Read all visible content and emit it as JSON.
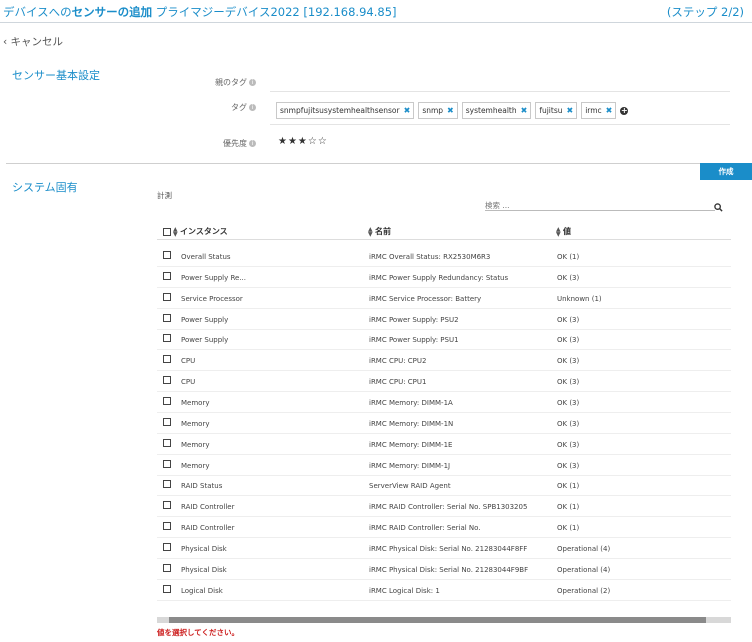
{
  "header": {
    "title_prefix": "デバイスへの",
    "title_bold": "センサーの追加",
    "title_suffix": " プライマジーデバイス2022 [192.168.94.85]",
    "step": "(ステップ 2/2)"
  },
  "cancel_label": "キャンセル",
  "basic_settings": {
    "section_title": "センサー基本設定",
    "parent_tags_label": "親のタグ",
    "tags_label": "タグ",
    "tags": [
      "snmpfujitsusystemhealthsensor",
      "snmp",
      "systemhealth",
      "fujitsu",
      "irmc"
    ],
    "priority_label": "優先度",
    "priority_stars": "★★★☆☆",
    "priority_value": 3
  },
  "system_specific": {
    "section_title": "システム固有",
    "create_button": "作成",
    "measurement_label": "計測",
    "search_placeholder": "検索 ..."
  },
  "table": {
    "columns": [
      "インスタンス",
      "名前",
      "値"
    ],
    "rows": [
      {
        "instance": "Overall Status",
        "name": "iRMC Overall Status: RX2530M6R3",
        "value": "OK (1)"
      },
      {
        "instance": "Power Supply Re...",
        "name": "iRMC Power Supply Redundancy: Status",
        "value": "OK (3)"
      },
      {
        "instance": "Service Processor",
        "name": "iRMC Service Processor: Battery",
        "value": "Unknown (1)"
      },
      {
        "instance": "Power Supply",
        "name": "iRMC Power Supply: PSU2",
        "value": "OK (3)"
      },
      {
        "instance": "Power Supply",
        "name": "iRMC Power Supply: PSU1",
        "value": "OK (3)"
      },
      {
        "instance": "CPU",
        "name": "iRMC CPU: CPU2",
        "value": "OK (3)"
      },
      {
        "instance": "CPU",
        "name": "iRMC CPU: CPU1",
        "value": "OK (3)"
      },
      {
        "instance": "Memory",
        "name": "iRMC Memory: DIMM-1A",
        "value": "OK (3)"
      },
      {
        "instance": "Memory",
        "name": "iRMC Memory: DIMM-1N",
        "value": "OK (3)"
      },
      {
        "instance": "Memory",
        "name": "iRMC Memory: DIMM-1E",
        "value": "OK (3)"
      },
      {
        "instance": "Memory",
        "name": "iRMC Memory: DIMM-1J",
        "value": "OK (3)"
      },
      {
        "instance": "RAID Status",
        "name": "ServerView RAID Agent",
        "value": "OK (1)"
      },
      {
        "instance": "RAID Controller",
        "name": "iRMC RAID Controller: Serial No. SPB1303205",
        "value": "OK (1)"
      },
      {
        "instance": "RAID Controller",
        "name": "iRMC RAID Controller: Serial No.",
        "value": "OK (1)"
      },
      {
        "instance": "Physical Disk",
        "name": "iRMC Physical Disk: Serial No. 21283044F8FF",
        "value": "Operational (4)"
      },
      {
        "instance": "Physical Disk",
        "name": "iRMC Physical Disk: Serial No. 21283044F9BF",
        "value": "Operational (4)"
      },
      {
        "instance": "Logical Disk",
        "name": "iRMC Logical Disk: 1",
        "value": "Operational (2)"
      }
    ]
  },
  "error_message": "値を選択してください。",
  "colors": {
    "accent": "#1a8dc9",
    "error": "#cc1e1e"
  },
  "icons": [
    "chevron-left-icon",
    "info-icon",
    "remove-tag-icon",
    "add-tag-icon",
    "search-icon",
    "sort-icon",
    "checkbox-icon"
  ]
}
